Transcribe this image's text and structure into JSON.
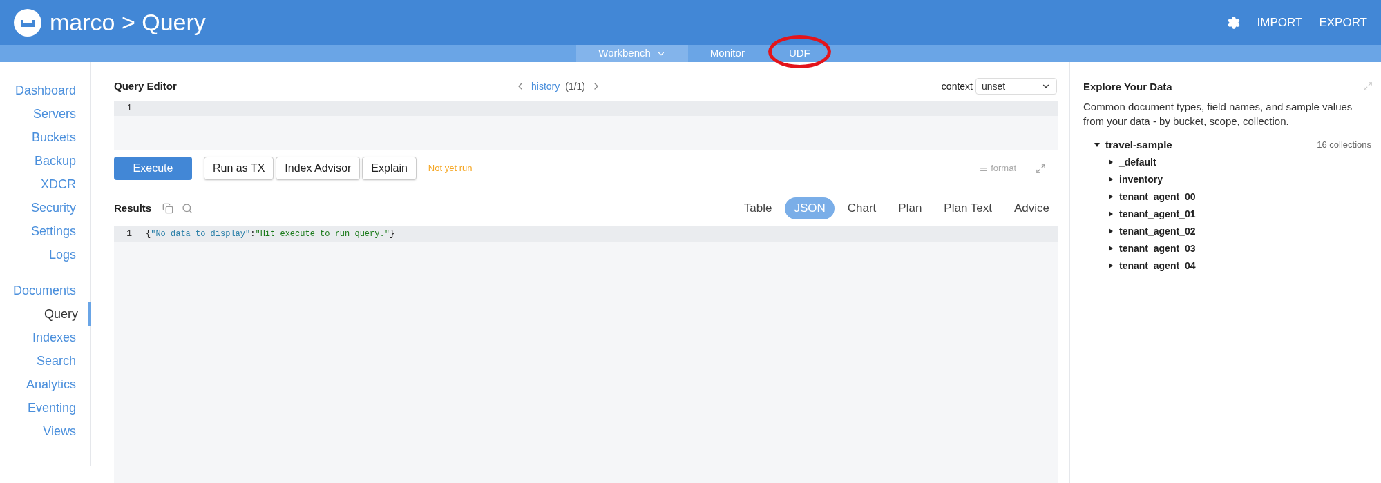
{
  "header": {
    "brand": "marco",
    "separator": ">",
    "page": "Query",
    "actions": [
      "IMPORT",
      "EXPORT"
    ]
  },
  "subnav": [
    {
      "label": "Workbench",
      "selected": true,
      "dropdown": true
    },
    {
      "label": "Monitor",
      "selected": false,
      "dropdown": false
    },
    {
      "label": "UDF",
      "selected": false,
      "dropdown": false,
      "highlighted": true
    }
  ],
  "sidebar": {
    "groups": [
      [
        {
          "label": "Dashboard",
          "selected": false
        },
        {
          "label": "Servers",
          "selected": false
        },
        {
          "label": "Buckets",
          "selected": false
        },
        {
          "label": "Backup",
          "selected": false
        },
        {
          "label": "XDCR",
          "selected": false
        },
        {
          "label": "Security",
          "selected": false
        },
        {
          "label": "Settings",
          "selected": false
        },
        {
          "label": "Logs",
          "selected": false
        }
      ],
      [
        {
          "label": "Documents",
          "selected": false
        },
        {
          "label": "Query",
          "selected": true
        },
        {
          "label": "Indexes",
          "selected": false
        },
        {
          "label": "Search",
          "selected": false
        },
        {
          "label": "Analytics",
          "selected": false
        },
        {
          "label": "Eventing",
          "selected": false
        },
        {
          "label": "Views",
          "selected": false
        }
      ]
    ]
  },
  "editor": {
    "title": "Query Editor",
    "history_link": "history",
    "history_count": "(1/1)",
    "context_label": "context",
    "context_value": "unset",
    "line_number": "1"
  },
  "buttons": [
    {
      "label": "Execute",
      "kind": "primary"
    },
    {
      "label": "Run as TX",
      "kind": "secondary"
    },
    {
      "label": "Index Advisor",
      "kind": "secondary"
    },
    {
      "label": "Explain",
      "kind": "secondary"
    }
  ],
  "status": "Not yet run",
  "format_label": "format",
  "results": {
    "title": "Results",
    "views": [
      {
        "label": "Table",
        "selected": false
      },
      {
        "label": "JSON",
        "selected": true
      },
      {
        "label": "Chart",
        "selected": false
      },
      {
        "label": "Plan",
        "selected": false
      },
      {
        "label": "Plan Text",
        "selected": false
      },
      {
        "label": "Advice",
        "selected": false
      }
    ],
    "line_number": "1",
    "tokens": [
      {
        "kind": "punct",
        "text": "{"
      },
      {
        "kind": "key",
        "text": "\"No data to display\""
      },
      {
        "kind": "punct",
        "text": ":"
      },
      {
        "kind": "string",
        "text": "\"Hit execute to run query.\""
      },
      {
        "kind": "punct",
        "text": "}"
      }
    ]
  },
  "explore": {
    "title": "Explore Your Data",
    "description": "Common document types, field names, and sample values from your data - by bucket, scope, collection.",
    "tree": [
      {
        "label": "travel-sample",
        "count": "16 collections",
        "expanded": true,
        "children": [
          {
            "label": "_default",
            "expanded": false
          },
          {
            "label": "inventory",
            "expanded": false
          },
          {
            "label": "tenant_agent_00",
            "expanded": false
          },
          {
            "label": "tenant_agent_01",
            "expanded": false
          },
          {
            "label": "tenant_agent_02",
            "expanded": false
          },
          {
            "label": "tenant_agent_03",
            "expanded": false
          },
          {
            "label": "tenant_agent_04",
            "expanded": false
          }
        ]
      }
    ]
  }
}
